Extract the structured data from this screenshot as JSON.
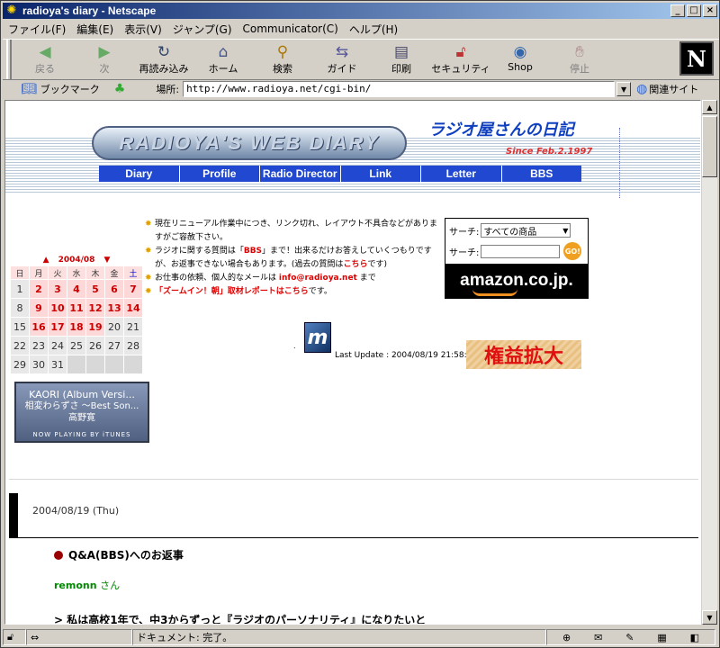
{
  "window": {
    "title": "radioya's diary - Netscape",
    "buttons": {
      "min": "_",
      "max": "□",
      "close": "×"
    }
  },
  "menu": [
    "ファイル(F)",
    "編集(E)",
    "表示(V)",
    "ジャンプ(G)",
    "Communicator(C)",
    "ヘルプ(H)"
  ],
  "toolbar": {
    "back": "戻る",
    "forward": "次",
    "reload": "再読み込み",
    "home": "ホーム",
    "search": "検索",
    "guide": "ガイド",
    "print": "印刷",
    "security": "セキュリティ",
    "shop": "Shop",
    "stop": "停止"
  },
  "location": {
    "bookmarks": "ブックマーク",
    "label": "場所:",
    "url": "http://www.radioya.net/cgi-bin/",
    "related": "関連サイト"
  },
  "header": {
    "logo": "RADIOYA'S WEB DIARY",
    "jp_title": "ラジオ屋さんの日記",
    "since": "Since Feb.2.1997",
    "nav": [
      "Diary",
      "Profile",
      "Radio Director",
      "Link",
      "Letter",
      "BBS"
    ]
  },
  "calendar": {
    "month": "2004/08",
    "prev": "▲",
    "next": "▼",
    "dow": [
      "日",
      "月",
      "火",
      "水",
      "木",
      "金",
      "土"
    ],
    "weeks": [
      [
        "1",
        "2",
        "3",
        "4",
        "5",
        "6",
        "7"
      ],
      [
        "8",
        "9",
        "10",
        "11",
        "12",
        "13",
        "14"
      ],
      [
        "15",
        "16",
        "17",
        "18",
        "19",
        "20",
        "21"
      ],
      [
        "22",
        "23",
        "24",
        "25",
        "26",
        "27",
        "28"
      ],
      [
        "29",
        "30",
        "31",
        "",
        "",
        "",
        ""
      ]
    ]
  },
  "itunes": {
    "line1": "KAORI (Album Versi...",
    "line2": "相変わらずさ ～Best Son...",
    "line3": "高野寛",
    "footer": "NOW PLAYING BY iTUNES"
  },
  "notice": {
    "p1": "現在リニューアル作業中につき、リンク切れ、レイアウト不具合などがありますがご容赦下さい。",
    "p2a": "ラジオに関する質問は「",
    "p2b": "BBS",
    "p2c": "」まで！出来るだけお答えしていくつもりですが、お返事できない場合もあります。(過去の質問は",
    "p2d": "こちら",
    "p2e": "です)",
    "p3a": "お仕事の依頼、個人的なメールは ",
    "p3b": "info@radioya.net",
    "p3c": " まで",
    "p4a": "「ズームイン！朝」取材レポートは",
    "p4b": "こちら",
    "p4c": "です。"
  },
  "amazon": {
    "search_label": "サーチ:",
    "select_value": "すべての商品",
    "search_label2": "サーチ:",
    "go": "GO!",
    "logo": "amazon.co.jp."
  },
  "mid": {
    "m_logo": "m",
    "dot": ".",
    "last_update": "Last Update : 2004/08/19 21:58:18",
    "banner": "権益拡大"
  },
  "entry": {
    "date": "2004/08/19 (Thu)",
    "title": "Q&A(BBS)へのお返事",
    "author_name": "remonn",
    "author_suffix": " さん",
    "quote": "> 私は高校1年で、中3からずっと『ラジオのパーソナリティ』になりたいと"
  },
  "status": {
    "text": "ドキュメント: 完了。"
  }
}
